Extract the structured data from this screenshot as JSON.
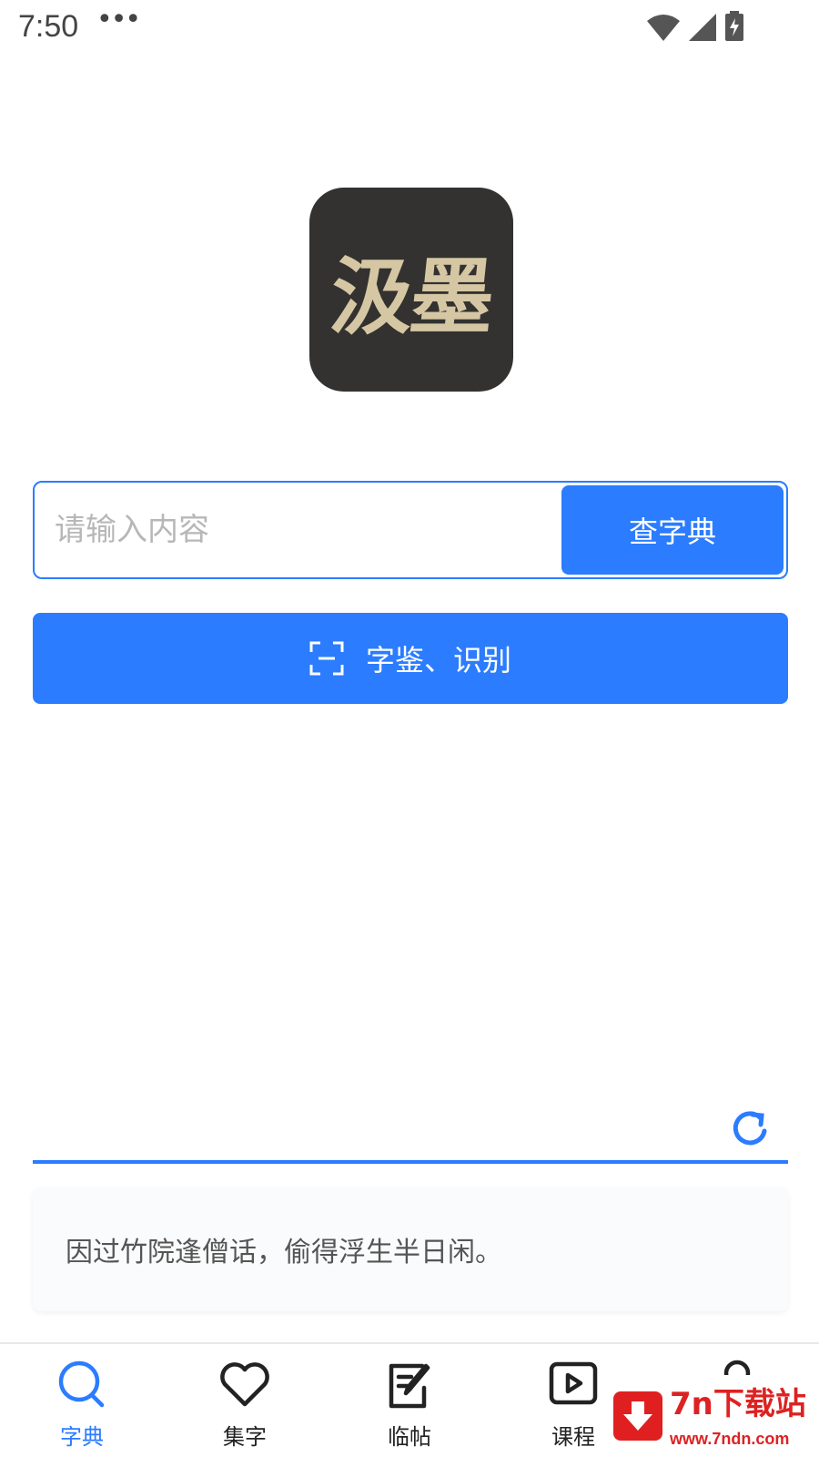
{
  "status_bar": {
    "time": "7:50",
    "overflow": "•••"
  },
  "logo": {
    "text": "汲墨",
    "background": "#333230",
    "ink_color": "#d6c7a4"
  },
  "search": {
    "placeholder": "请输入内容",
    "value": "",
    "button_label": "查字典"
  },
  "scan_button": {
    "label": "字鉴、识别",
    "icon": "scan-frame-icon"
  },
  "quote": {
    "text": "因过竹院逢僧话，偷得浮生半日闲。"
  },
  "accent_color": "#2b7cff",
  "bottom_nav": {
    "items": [
      {
        "label": "字典",
        "icon": "search-icon",
        "active": true
      },
      {
        "label": "集字",
        "icon": "heart-icon",
        "active": false
      },
      {
        "label": "临帖",
        "icon": "edit-icon",
        "active": false
      },
      {
        "label": "课程",
        "icon": "video-icon",
        "active": false
      },
      {
        "label": "",
        "icon": "user-icon",
        "active": false
      }
    ]
  },
  "watermark": {
    "title": "7n下载站",
    "url": "www.7ndn.com"
  }
}
